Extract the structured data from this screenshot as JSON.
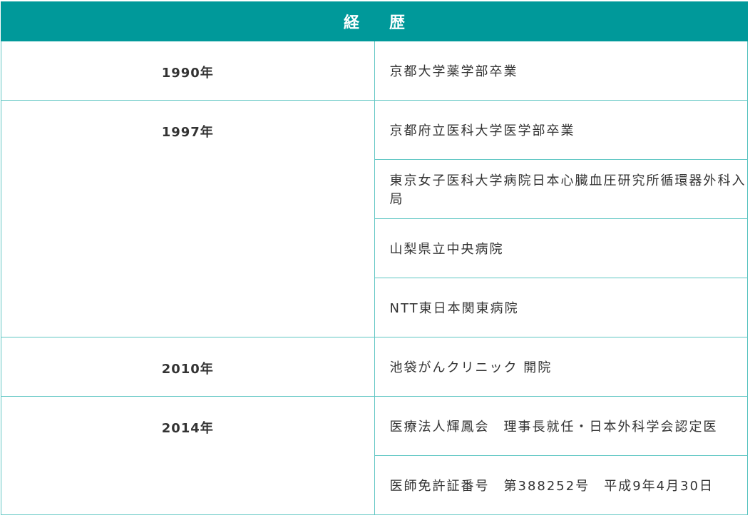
{
  "table": {
    "heading": "経　歴",
    "entries": [
      {
        "year": "1990年",
        "events": [
          "京都大学薬学部卒業"
        ]
      },
      {
        "year": "1997年",
        "events": [
          "京都府立医科大学医学部卒業",
          "東京女子医科大学病院日本心臓血圧研究所循環器外科入局",
          "山梨県立中央病院",
          "NTT東日本関東病院"
        ]
      },
      {
        "year": "2010年",
        "events": [
          "池袋がんクリニック 開院"
        ]
      },
      {
        "year": "2014年",
        "events": [
          "医療法人輝鳳会　理事長就任・日本外科学会認定医",
          "医師免許証番号　第388252号　平成9年4月30日"
        ]
      }
    ]
  },
  "colors": {
    "header_bg": "#00999a",
    "border": "#5fc6c3",
    "text": "#333333"
  }
}
